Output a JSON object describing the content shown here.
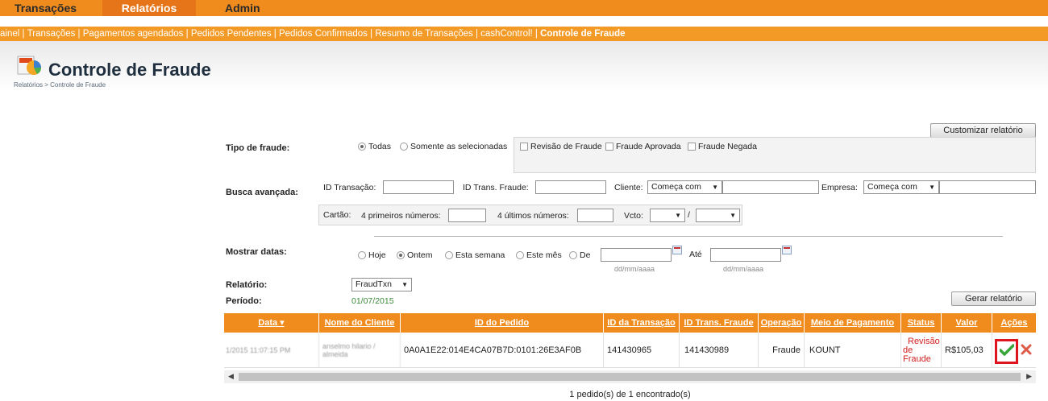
{
  "topnav": {
    "tabs": [
      "Transações",
      "Relatórios",
      "Admin"
    ],
    "active": "Relatórios"
  },
  "subnav": {
    "items": [
      "ainel",
      "Transações",
      "Pagamentos agendados",
      "Pedidos Pendentes",
      "Pedidos Confirmados",
      "Resumo de Transações",
      "cashControl!",
      "Controle de Fraude"
    ],
    "current": "Controle de Fraude"
  },
  "page": {
    "title": "Controle de Fraude",
    "breadcrumb": "Relatórios > Controle de Fraude",
    "customize_button": "Customizar relatório"
  },
  "fraud_type": {
    "label": "Tipo de fraude:",
    "options": [
      "Todas",
      "Somente as selecionadas"
    ],
    "selected": "Todas",
    "checkboxes": [
      "Revisão de Fraude",
      "Fraude Aprovada",
      "Fraude Negada"
    ]
  },
  "advanced": {
    "label": "Busca avançada:",
    "id_transacao": "ID Transação:",
    "id_trans_fraude": "ID Trans. Fraude:",
    "cliente": "Cliente:",
    "cliente_mode": "Começa com",
    "empresa": "Empresa:",
    "empresa_mode": "Começa com",
    "cartao": "Cartão:",
    "primeiros": "4 primeiros números:",
    "ultimos": "4 últimos números:",
    "vcto": "Vcto:",
    "vcto_sep": "/"
  },
  "dates": {
    "label": "Mostrar datas:",
    "options": [
      "Hoje",
      "Ontem",
      "Esta semana",
      "Este mês",
      "De"
    ],
    "selected": "Ontem",
    "ate": "Até",
    "format_hint": "dd/mm/aaaa"
  },
  "report": {
    "label": "Relatório:",
    "value": "FraudTxn",
    "period_label": "Período:",
    "period_value": "01/07/2015",
    "generate_button": "Gerar relatório"
  },
  "table": {
    "headers": [
      "Data ▾",
      "Nome do Cliente",
      "ID do Pedido",
      "ID da Transação",
      "ID Trans. Fraude",
      "Operação",
      "Meio de Pagamento",
      "Status",
      "Valor",
      "Ações"
    ],
    "rows": [
      {
        "data": "1/2015 11:07:15 PM",
        "cliente": "anselmo hilario / almeida",
        "pedido": "0A0A1E22:014E4CA07B7D:0101:26E3AF0B",
        "transacao": "141430965",
        "trans_fraude": "141430989",
        "operacao": "Fraude",
        "meio": "KOUNT",
        "status": [
          "Revisão",
          "de",
          "Fraude"
        ],
        "valor": "R$105,03"
      }
    ],
    "footer": "1 pedido(s) de 1 encontrado(s)"
  },
  "colors": {
    "nav": "#f08c1e",
    "nav_active": "#e6751a",
    "status_red": "#d02020",
    "approve_green": "#3aa53a",
    "highlight": "#e0141e"
  }
}
